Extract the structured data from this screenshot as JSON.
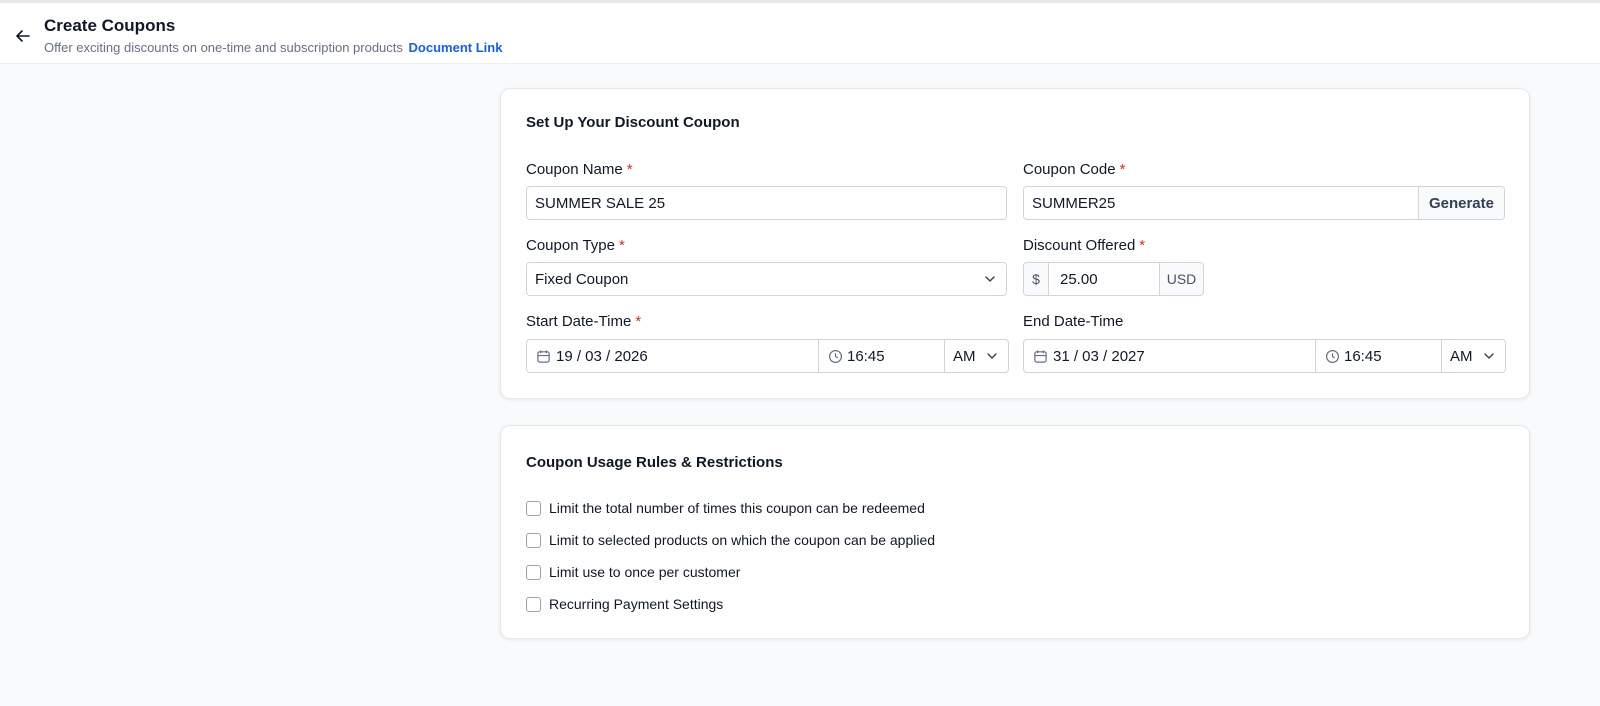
{
  "header": {
    "title": "Create Coupons",
    "subtitle": "Offer exciting discounts on one-time and subscription products",
    "doc_link": "Document Link"
  },
  "setup": {
    "title": "Set Up Your Discount Coupon",
    "coupon_name": {
      "label": "Coupon Name",
      "value": "SUMMER SALE 25"
    },
    "coupon_code": {
      "label": "Coupon Code",
      "value": "SUMMER25",
      "generate_label": "Generate"
    },
    "coupon_type": {
      "label": "Coupon Type",
      "value": "Fixed Coupon"
    },
    "discount": {
      "label": "Discount Offered",
      "prefix": "$",
      "value": "25.00",
      "suffix": "USD"
    },
    "start": {
      "label": "Start Date-Time",
      "date": "19 / 03 / 2026",
      "time": "16:45",
      "ampm": "AM"
    },
    "end": {
      "label": "End Date-Time",
      "date": "31 / 03 / 2027",
      "time": "16:45",
      "ampm": "AM"
    },
    "required_mark": "*"
  },
  "rules": {
    "title": "Coupon Usage Rules & Restrictions",
    "items": [
      "Limit the total number of times this coupon can be redeemed",
      "Limit to selected products on which the coupon can be applied",
      "Limit use to once per customer",
      "Recurring Payment Settings"
    ]
  },
  "colors": {
    "accent": "#155eef",
    "required": "#d92d20"
  }
}
